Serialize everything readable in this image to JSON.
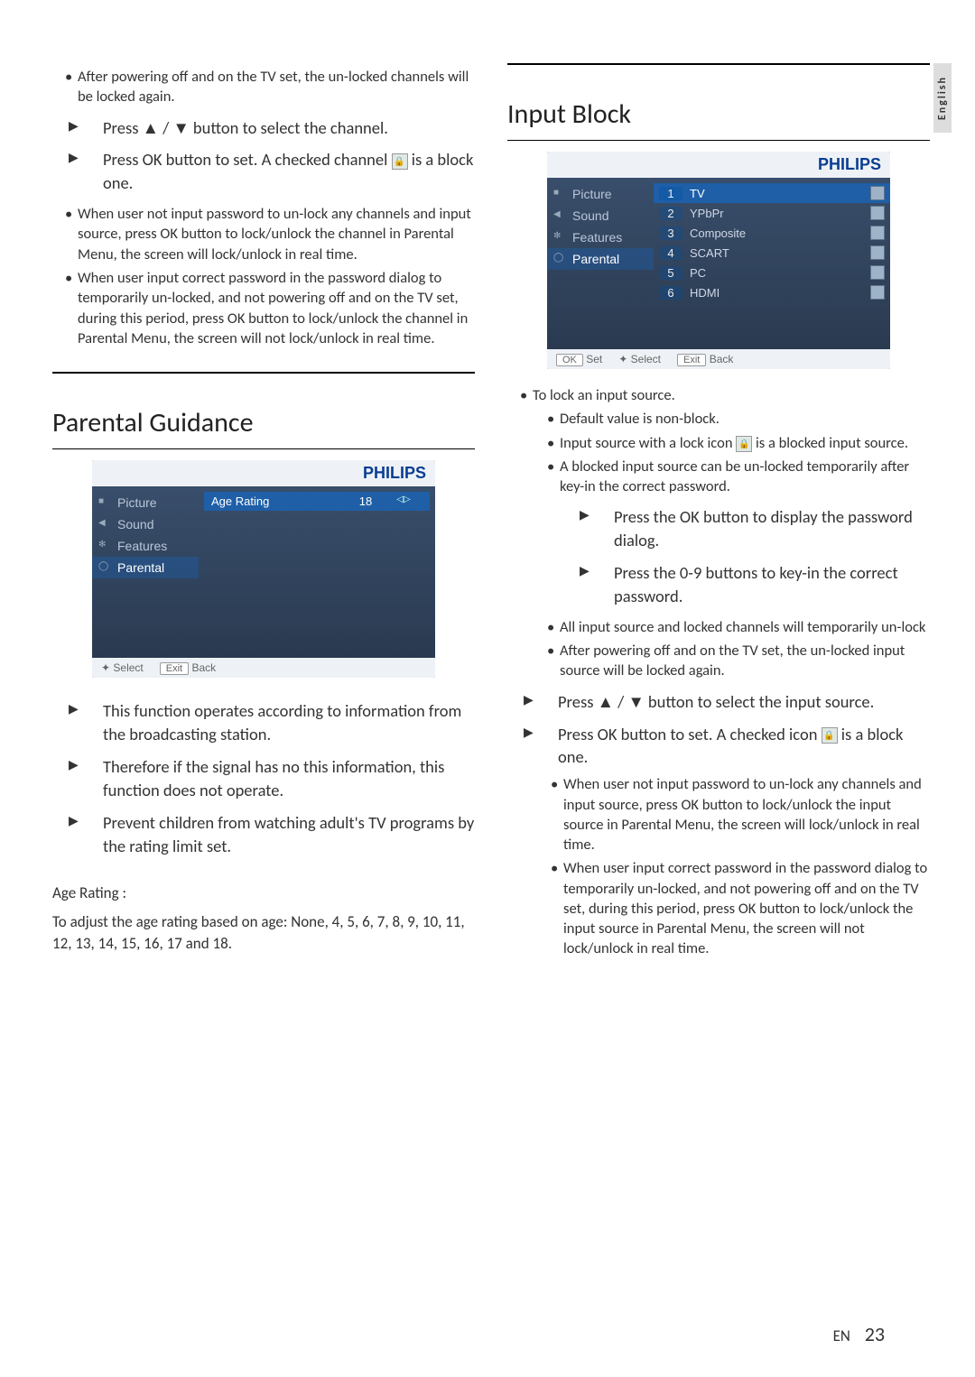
{
  "side_tab": "English",
  "footer": {
    "lang": "EN",
    "page": "23"
  },
  "left": {
    "intro_bullet": "After powering off and on the TV set, the un-locked channels will be locked again.",
    "arrow1": "Press ▲ / ▼ button to select the channel.",
    "arrow2_a": "Press OK button to set. A checked channel ",
    "arrow2_b": " is a block one.",
    "note1": "When user not input password to un-lock any channels and input source, press OK button to lock/unlock the channel in Parental Menu, the screen will lock/unlock in real time.",
    "note2": "When user input correct password in the password dialog to temporarily un-locked, and not powering off and on the TV set, during this period, press OK button to lock/unlock the channel in Parental Menu, the screen will not lock/unlock in real time.",
    "section_title": "Parental Guidance",
    "tv": {
      "brand": "PHILIPS",
      "nav": [
        "Picture",
        "Sound",
        "Features",
        "Parental"
      ],
      "nav_icons": [
        "■",
        "◀",
        "✻",
        "◯"
      ],
      "age_label": "Age Rating",
      "age_value": "18",
      "foot_select": "Select",
      "foot_exit": "Exit",
      "foot_back": "Back"
    },
    "pg_arrow1": "This function operates according to information from the broadcasting station.",
    "pg_arrow2": "Therefore if the signal has no this information, this function does not operate.",
    "pg_arrow3": "Prevent children from watching adult's TV programs by the rating limit set.",
    "age_rating_label": "Age Rating :",
    "age_rating_desc": "To adjust the age rating based on age: None, 4, 5, 6, 7, 8, 9, 10, 11, 12, 13, 14, 15, 16, 17 and 18."
  },
  "right": {
    "section_title": "Input Block",
    "tv": {
      "brand": "PHILIPS",
      "nav": [
        "Picture",
        "Sound",
        "Features",
        "Parental"
      ],
      "nav_icons": [
        "■",
        "◀",
        "✻",
        "◯"
      ],
      "rows": [
        {
          "n": "1",
          "name": "TV",
          "hi": true
        },
        {
          "n": "2",
          "name": "YPbPr"
        },
        {
          "n": "3",
          "name": "Composite"
        },
        {
          "n": "4",
          "name": "SCART"
        },
        {
          "n": "5",
          "name": "PC"
        },
        {
          "n": "6",
          "name": "HDMI"
        }
      ],
      "foot_ok": "OK",
      "foot_set": "Set",
      "foot_select": "Select",
      "foot_exit": "Exit",
      "foot_back": "Back"
    },
    "b1": "To lock an input source.",
    "b1a": "Default value is non-block.",
    "b1b_a": "Input source with a lock icon ",
    "b1b_b": " is a blocked input source.",
    "b1c": "A blocked input source can be un-locked temporarily after key-in the correct password.",
    "b1c_arrow1": "Press the OK button to display the password dialog.",
    "b1c_arrow2": "Press the 0-9 buttons to key-in the correct password.",
    "b1d": "All input source and locked channels will temporarily un-lock",
    "b1e": "After powering off and on the TV set, the un-locked input source will be locked again.",
    "arrow_sel": "Press ▲ / ▼ button to select the input source.",
    "arrow_set_a": "Press OK button to set. A checked icon ",
    "arrow_set_b": " is a block one.",
    "note1": "When user not input password to un-lock any channels and input source, press OK button to lock/unlock the input source in Parental Menu, the screen will lock/unlock in real time.",
    "note2": "When user input correct password in the password dialog to temporarily un-locked, and not powering off and on the TV set, during this period, press OK button to lock/unlock the input source in Parental Menu, the screen will not lock/unlock in real time."
  }
}
